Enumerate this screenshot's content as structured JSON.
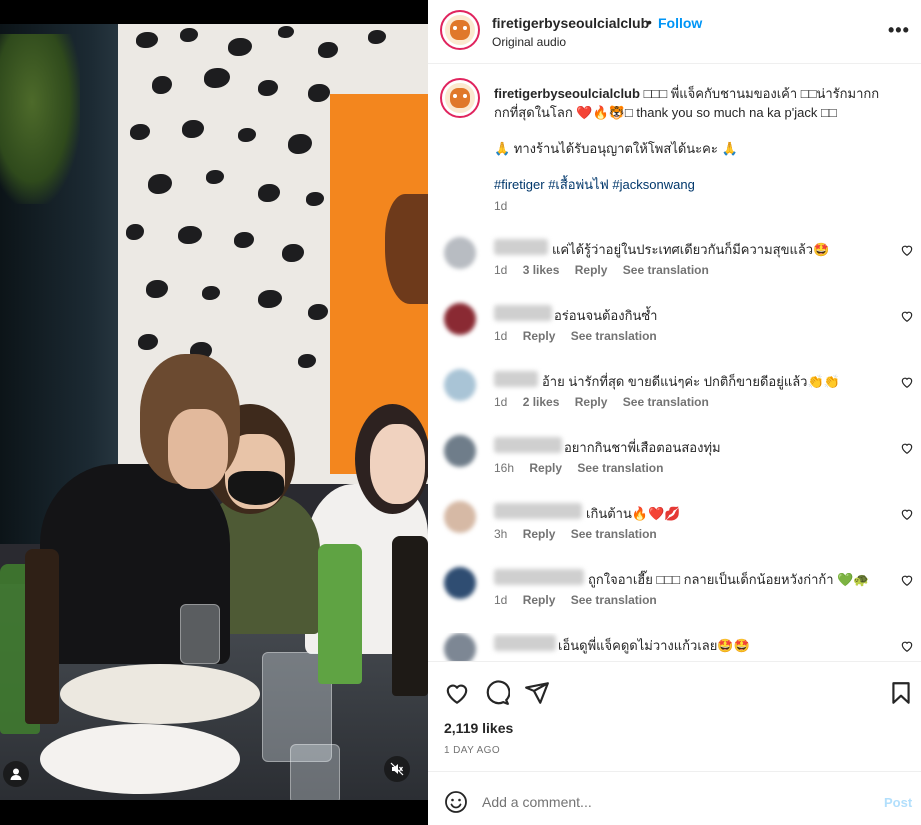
{
  "header": {
    "username": "firetigerbyseoulcialclub",
    "separator": "•",
    "follow_label": "Follow",
    "audio": "Original audio",
    "more_label": "•••"
  },
  "caption": {
    "username": "firetigerbyseoulcialclub",
    "line1": "□□□ พี่แจ็คกับชานมของเค้า □□น่ารักมากกกกที่สุดในโลก ❤️🔥🐯□ thank you so much na ka p'jack □□",
    "line2": "🙏 ทางร้านได้รับอนุญาตให้โพสได้นะคะ 🙏",
    "tags": "#firetiger #เสื้อพ่นไฟ #jacksonwang",
    "time": "1d"
  },
  "comments": [
    {
      "text": "แค่ได้รู้ว่าอยู่ในประเทศเดียวกันก็มีความสุขแล้ว🤩",
      "time": "1d",
      "likes": "3 likes",
      "reply": "Reply",
      "translate": "See translation"
    },
    {
      "text": "อร่อนจนต้องกินซ้ำ",
      "time": "1d",
      "likes": "",
      "reply": "Reply",
      "translate": "See translation"
    },
    {
      "text": "อ้าย น่ารักที่สุด ขายดีแน่ๆค่ะ ปกติก็ขายดีอยู่แล้ว👏👏",
      "time": "1d",
      "likes": "2 likes",
      "reply": "Reply",
      "translate": "See translation"
    },
    {
      "text": "อยากกินชาพี่เสือตอนสองทุ่ม",
      "time": "16h",
      "likes": "",
      "reply": "Reply",
      "translate": "See translation"
    },
    {
      "text": "เกินต้าน🔥❤️💋",
      "time": "3h",
      "likes": "",
      "reply": "Reply",
      "translate": "See translation"
    },
    {
      "text": "ถูกใจอาเฮี๊ย □□□ กลายเป็นเด็กน้อยหวังก่าก้า 💚🐢",
      "time": "1d",
      "likes": "",
      "reply": "Reply",
      "translate": "See translation"
    },
    {
      "text": "เอ็นดูพี่แจ็คดูดไม่วางแก้วเลย🤩🤩",
      "time": "",
      "likes": "",
      "reply": "",
      "translate": ""
    }
  ],
  "likes_count": "2,119 likes",
  "time_ago": "1 DAY AGO",
  "comment_box": {
    "placeholder": "Add a comment...",
    "post_label": "Post"
  },
  "colors": {
    "follow_blue": "#0095f6",
    "hashtag_blue": "#00376b",
    "post_disabled": "#b2dffc",
    "avatar_ring": "#e0245e"
  },
  "icons": [
    "heart-icon",
    "comment-icon",
    "share-icon",
    "bookmark-icon",
    "emoji-icon",
    "user-tag-icon",
    "mute-icon",
    "more-icon"
  ]
}
